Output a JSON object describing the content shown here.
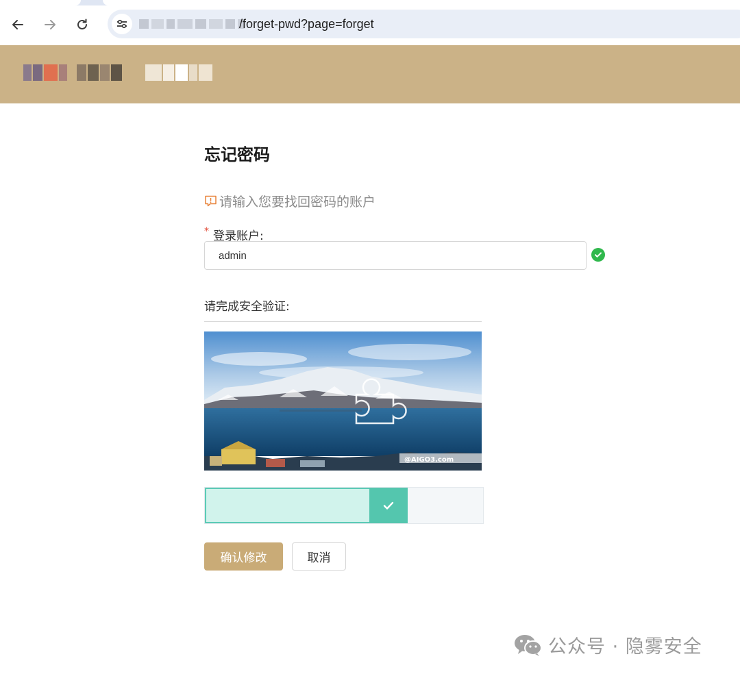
{
  "browser": {
    "url_visible": "/forget-pwd?page=forget",
    "icons": {
      "back": "arrow-left-icon",
      "forward": "arrow-right-icon",
      "reload": "reload-icon",
      "site_info": "tune-icon"
    }
  },
  "site_header": {
    "background": "#cbb287",
    "brand_accent": "#e07050"
  },
  "page": {
    "title": "忘记密码",
    "hint": "请输入您要找回密码的账户",
    "account_label": "登录账户:",
    "required_mark": "*",
    "account_value": "admin",
    "verify_label": "请完成安全验证:",
    "captcha_watermark": "@AIGO3.com"
  },
  "slider": {
    "progress": 0.73,
    "state": "verified"
  },
  "buttons": {
    "confirm": "确认修改",
    "cancel": "取消"
  },
  "watermark": {
    "text": "公众号 · 隐雾安全",
    "icon": "wechat-icon"
  },
  "colors": {
    "primary": "#c9ab77",
    "success": "#30b84d",
    "slider_accent": "#54c6ae",
    "hint_icon": "#e8833a"
  }
}
